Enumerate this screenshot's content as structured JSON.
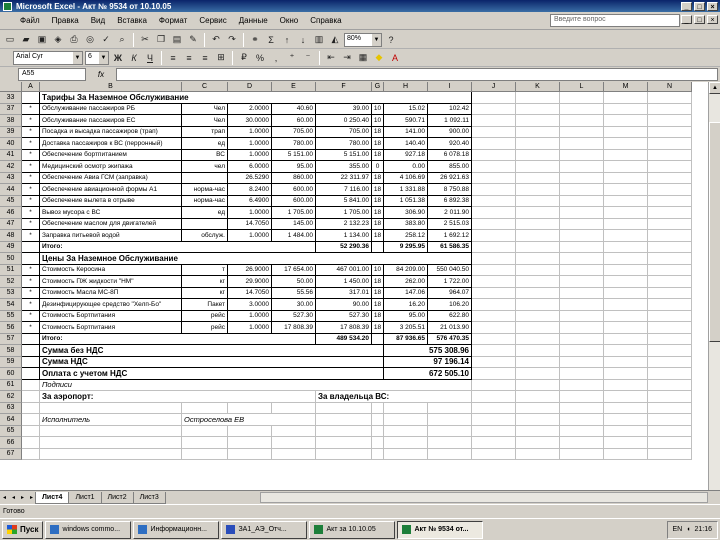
{
  "window": {
    "title": "Microsoft Excel - Акт № 9534 от 10.10.05"
  },
  "menu": [
    "Файл",
    "Правка",
    "Вид",
    "Вставка",
    "Формат",
    "Сервис",
    "Данные",
    "Окно",
    "Справка"
  ],
  "help_box": {
    "placeholder": "Введите вопрос"
  },
  "toolbar": {
    "zoom": "80%",
    "font_name": "Arial Cyr",
    "font_size": "6"
  },
  "formula_bar": {
    "name_box": "A55",
    "fx": "fx",
    "value": ""
  },
  "columns": [
    "A",
    "B",
    "C",
    "D",
    "E",
    "F",
    "G",
    "H",
    "I",
    "J",
    "K",
    "L",
    "M",
    "N"
  ],
  "rows": [
    {
      "num": "33",
      "kind": "section",
      "text": "Тарифы За Наземное Обслуживание"
    },
    {
      "num": "37",
      "cells": [
        "*",
        "Обслуживание пассажиров РБ",
        "Чел",
        "2.0000",
        "40.60",
        "39.00",
        "10",
        "15.02",
        "102.42"
      ]
    },
    {
      "num": "38",
      "cells": [
        "*",
        "Обслуживание пассажиров ЕС",
        "Чел",
        "30.0000",
        "60.00",
        "0 250.40",
        "10",
        "590.71",
        "1 092.11"
      ]
    },
    {
      "num": "39",
      "cells": [
        "*",
        "Посадка и высадка пассажиров (трап)",
        "трап",
        "1.0000",
        "705.00",
        "705.00",
        "18",
        "141.00",
        "900.00"
      ]
    },
    {
      "num": "40",
      "cells": [
        "*",
        "Доставка пассажиров к ВС (перронный)",
        "ед",
        "1.0000",
        "780.00",
        "780.00",
        "18",
        "140.40",
        "920.40"
      ]
    },
    {
      "num": "41",
      "cells": [
        "*",
        "Обеспечение бортпитанием",
        "ВС",
        "1.0000",
        "5 151.00",
        "5 151.00",
        "18",
        "927.18",
        "6 078.18"
      ]
    },
    {
      "num": "42",
      "cells": [
        "*",
        "Медицинский осмотр экипажа",
        "чел",
        "6.0000",
        "95.00",
        "355.00",
        "0",
        "0.00",
        "855.00"
      ]
    },
    {
      "num": "43",
      "cells": [
        "*",
        "Обеспечение Авиа ГСМ (заправка)",
        "",
        "26.5290",
        "860.00",
        "22 311.97",
        "18",
        "4 106.69",
        "26 921.63"
      ]
    },
    {
      "num": "44",
      "cells": [
        "*",
        "Обеспечение авиационной формы А1",
        "норма-час",
        "8.2400",
        "600.00",
        "7 116.00",
        "18",
        "1 331.88",
        "8 750.88"
      ]
    },
    {
      "num": "45",
      "cells": [
        "*",
        "Обеспечение вылета в отрыве",
        "норма-час",
        "6.4900",
        "600.00",
        "5 841.00",
        "18",
        "1 051.38",
        "6 892.38"
      ]
    },
    {
      "num": "46",
      "cells": [
        "*",
        "Вывоз мусора с ВС",
        "ед",
        "1.0000",
        "1 705.00",
        "1 705.00",
        "18",
        "306.90",
        "2 011.90"
      ]
    },
    {
      "num": "47",
      "cells": [
        "*",
        "Обеспечение маслом для двигателей",
        "",
        "14.7050",
        "145.00",
        "2 132.23",
        "18",
        "383.80",
        "2 515.03"
      ]
    },
    {
      "num": "48",
      "cells": [
        "*",
        "Заправка питьевой водой",
        "обслуж.",
        "1.0000",
        "1 484.00",
        "1 134.00",
        "18",
        "258.12",
        "1 692.12"
      ]
    },
    {
      "num": "49",
      "kind": "total",
      "label": "Итого:",
      "f": "52 290.36",
      "h": "9 295.95",
      "i": "61 586.35"
    },
    {
      "num": "50",
      "kind": "section",
      "text": "Цены За Наземное Обслуживание"
    },
    {
      "num": "51",
      "cells": [
        "*",
        "Стоимость Керосина",
        "т",
        "26.9000",
        "17 654.00",
        "467 001.00",
        "10",
        "84 209.00",
        "550 040.50"
      ]
    },
    {
      "num": "52",
      "cells": [
        "*",
        "Стоимость ПЖ жидкости \"НМ\"",
        "кг",
        "29.9000",
        "50.00",
        "1 450.00",
        "18",
        "262.00",
        "1 722.00"
      ]
    },
    {
      "num": "53",
      "cells": [
        "*",
        "Стоимость Масла МС-8П",
        "кг",
        "14.7050",
        "55.56",
        "317.01",
        "18",
        "147.06",
        "964.07"
      ]
    },
    {
      "num": "54",
      "cells": [
        "*",
        "Дезинфицирующее средство \"Хелп-Бо\"",
        "Пакет",
        "3.0000",
        "30.00",
        "90.00",
        "18",
        "16.20",
        "106.20"
      ]
    },
    {
      "num": "55",
      "cells": [
        "*",
        "Стоимость Бортпитания",
        "рейс",
        "1.0000",
        "527.30",
        "527.30",
        "18",
        "95.00",
        "622.80"
      ]
    },
    {
      "num": "56",
      "cells": [
        "*",
        "Стоимость Бортпитания",
        "рейс",
        "1.0000",
        "17 808.39",
        "17 808.39",
        "18",
        "3 205.51",
        "21 013.90"
      ]
    },
    {
      "num": "57",
      "kind": "total",
      "label": "Итого:",
      "f": "489 534.20",
      "h": "87 936.65",
      "i": "576 470.35"
    },
    {
      "num": "58",
      "kind": "summary",
      "label": "Сумма без НДС",
      "value": "575 308.96"
    },
    {
      "num": "59",
      "kind": "summary",
      "label": "Сумма НДС",
      "value": "97 196.14"
    },
    {
      "num": "60",
      "kind": "summary",
      "label": "Оплата с учетом НДС",
      "value": "672 505.10"
    },
    {
      "num": "61",
      "kind": "note",
      "text": "Подписи"
    },
    {
      "num": "62",
      "kind": "sign",
      "left": "За аэропорт:",
      "right": "За владельца ВС:"
    },
    {
      "num": "63",
      "kind": "blank"
    },
    {
      "num": "64",
      "kind": "exec",
      "left": "Исполнитель",
      "right": "Остроселова ЕВ"
    },
    {
      "num": "65",
      "kind": "blank"
    },
    {
      "num": "66",
      "kind": "blank"
    },
    {
      "num": "67",
      "kind": "blank"
    }
  ],
  "sheets": [
    "Лист4",
    "Лист1",
    "Лист2",
    "Лист3"
  ],
  "active_sheet": "Лист4",
  "status": "Готово",
  "taskbar": {
    "start": "Пуск",
    "tasks": [
      "windows commo...",
      "Информационн...",
      "ЗА1_АЭ_Отч...",
      "Акт за 10.10.05",
      "Акт № 9534 от..."
    ],
    "clock": "21:16",
    "lang": "EN"
  }
}
